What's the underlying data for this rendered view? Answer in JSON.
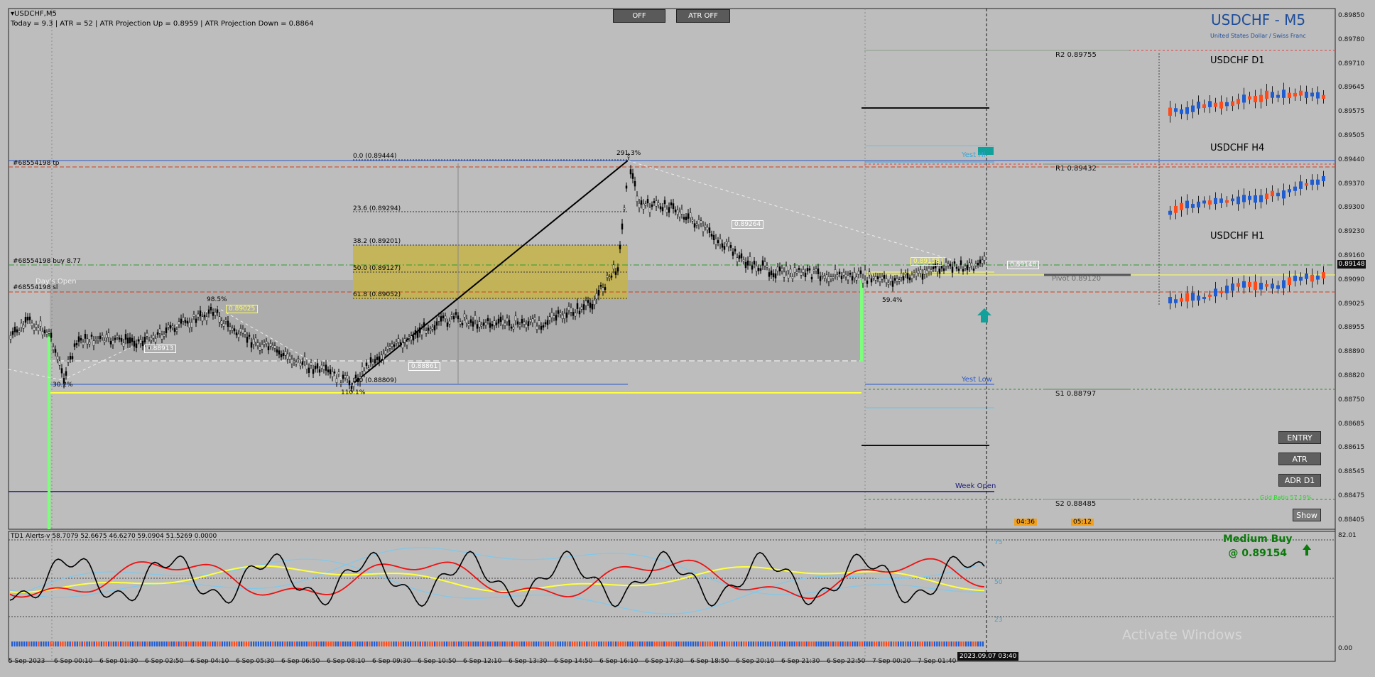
{
  "header": {
    "symbol": "USDCHF,M5",
    "stats": "Today = 9.3   |   ATR = 52   |   ATR Projection Up = 0.8959   |   ATR Projection Down = 0.8864"
  },
  "buttons": {
    "off": "OFF",
    "atr_off": "ATR OFF",
    "entry": "ENTRY",
    "atr": "ATR",
    "adr_d1": "ADR D1",
    "show": "Show"
  },
  "panel": {
    "title": "USDCHF - M5",
    "subtitle": "United States Dollar / Swiss Franc",
    "d1": "USDCHF D1",
    "h4": "USDCHF H4",
    "h1": "USDCHF H1"
  },
  "pivots": {
    "r2": "R2 0.89755",
    "r1": "R1 0.89432",
    "pivot": "Pivot 0.89120",
    "s1": "S1 0.88797",
    "s2": "S2 0.88485"
  },
  "fib": {
    "f0": "0.0 (0.89444)",
    "f236": "23.6 (0.89294)",
    "f382": "38.2 (0.89201)",
    "f50": "50.0 (0.89127)",
    "f618": "61.8 (0.89052)",
    "f100": "0.0 (0.88809)"
  },
  "orders": {
    "tp": "#68554198 tp",
    "buy": "#68554198 buy 8.77",
    "sl": "#68554198 sl"
  },
  "labels": {
    "pct291": "291.3%",
    "pct98": "98.5%",
    "pct30": "30.2%",
    "pct110": "110.1%",
    "pct59": "59.4%",
    "p89025": "0.89025",
    "p88913": "0.88913",
    "p88861": "0.88861",
    "p89264": "0.89264",
    "p89158": "0.89158",
    "p89148": "0.89148",
    "yest_low": "Yest Low",
    "week_open": "Week Open",
    "yest_hi": "Yest Hi",
    "days_open": "Day's Open",
    "grid": "Grid Ratio 57.19%",
    "t1": "04:36",
    "t2": "05:12"
  },
  "price_axis": [
    "0.89850",
    "0.89780",
    "0.89710",
    "0.89645",
    "0.89575",
    "0.89505",
    "0.89440",
    "0.89370",
    "0.89300",
    "0.89230",
    "0.89160",
    "0.89090",
    "0.89025",
    "0.88955",
    "0.88890",
    "0.88820",
    "0.88750",
    "0.88685",
    "0.88615",
    "0.88545",
    "0.88475",
    "0.88405"
  ],
  "current_price": "0.89148",
  "time_axis": [
    "5 Sep 2023",
    "6 Sep 00:10",
    "6 Sep 01:30",
    "6 Sep 02:50",
    "6 Sep 04:10",
    "6 Sep 05:30",
    "6 Sep 06:50",
    "6 Sep 08:10",
    "6 Sep 09:30",
    "6 Sep 10:50",
    "6 Sep 12:10",
    "6 Sep 13:30",
    "6 Sep 14:50",
    "6 Sep 16:10",
    "6 Sep 17:30",
    "6 Sep 18:50",
    "6 Sep 20:10",
    "6 Sep 21:30",
    "6 Sep 22:50",
    "7 Sep 00:20",
    "7 Sep 01:40"
  ],
  "time_cursor": "2023.09.07 03:40",
  "indicator": {
    "label": "TD1 Alerts-v 58.7079 52.6675 46.6270 59.0904 51.5269 0.0000",
    "axis_top": "82.01",
    "lv75": "75",
    "lv50": "50",
    "lv23": "23",
    "axis_bottom": "0.00"
  },
  "signal": {
    "title": "Medium Buy",
    "price": "@ 0.89154"
  },
  "watermark": "Activate Windows",
  "colors": {
    "bg": "#bdbdbd",
    "bull": "#1f5bd1",
    "bear": "#ff4a1a",
    "pivot_yellow": "#ffff4a",
    "grey_box": "#a8a8a8",
    "fib_zone": "#c9b94f"
  }
}
